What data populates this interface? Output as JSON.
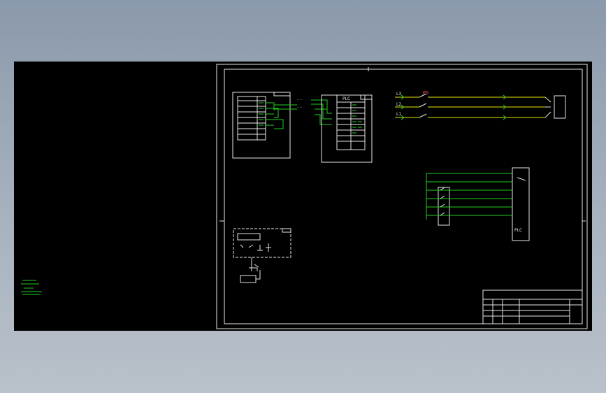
{
  "drawing": {
    "left_panel_note": [
      "",
      ""
    ],
    "panel_box": {
      "title": "",
      "tag": "",
      "caption": ""
    },
    "plc_box": {
      "title": "PLC",
      "tag": ""
    },
    "power": {
      "phases": [
        "L3",
        "L2",
        "L1"
      ],
      "fuse": "FS",
      "motor": ""
    },
    "plc_io": {
      "label": "PLC",
      "notes": [
        "",
        "",
        "",
        "",
        ""
      ]
    },
    "small_box": {
      "title": "",
      "tag": ""
    },
    "title_block": {
      "drawing_title": "",
      "drawing_number": "",
      "project": "",
      "rows": [
        "",
        "",
        ""
      ]
    }
  },
  "colors": {
    "background": "#000000",
    "frame": "#e6e6e6",
    "wire_green": "#22cc22",
    "wire_yellow": "#e6e600",
    "accent_red": "#ff5555"
  }
}
